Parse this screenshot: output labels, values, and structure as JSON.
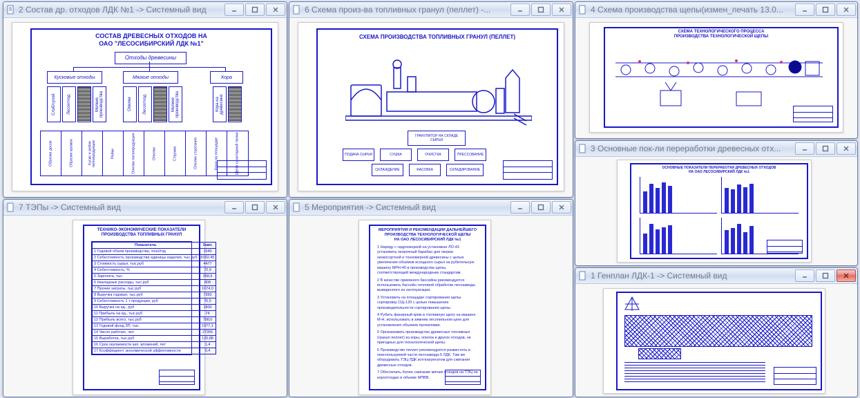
{
  "colors": {
    "line": "#1717c9"
  },
  "windows": {
    "w1": {
      "title": "2 Состав др. отходов ЛДК №1 -> Системный вид"
    },
    "w2": {
      "title": "6 Схема произ-ва топливных гранул (пеллет) -..."
    },
    "w3": {
      "title": "4 Схема производства щепы(измен_печать 13.0..."
    },
    "w4": {
      "title": "7 ТЭПы -> Системный вид"
    },
    "w5": {
      "title": "5 Мероприятия -> Системный вид"
    },
    "w6": {
      "title": "3 Основные пок-ли переработки древесных отх..."
    },
    "w7": {
      "title": "1 Генплан ЛДК-1 -> Системный вид"
    }
  },
  "w1_drawing": {
    "title1": "СОСТАВ ДРЕВЕСНЫХ ОТХОДОВ НА",
    "title2": "ОАО \"ЛЕСОСИБИРСКИЙ ЛДК №1\"",
    "root": "Отходы древесины",
    "level2": [
      "Кусковые отходы",
      "Мягкие отходы",
      "Кора"
    ],
    "kusk": [
      "Слэб/сухой",
      "Лесоотход",
      "Мелкие производства"
    ],
    "myag": [
      "Опилки",
      "Лесоотход",
      "Мелкие производства"
    ],
    "kora": [
      "Кора на древесине"
    ],
    "bottom": [
      "Обрезки досок",
      "Обрезки кромок",
      "Куски и рейки пилопродукции",
      "Рейки",
      "Опилки пилопродукции",
      "Опилки",
      "Стружки",
      "Опилки строгания",
      "Кора на площадке",
      "Щепа санитарной пилки"
    ]
  },
  "w2_drawing": {
    "title": "СХЕМА ПРОИЗВОДСТВА ТОПЛИВНЫХ ГРАНУЛ (ПЕЛЛЕТ)",
    "flow_center": "ГРАНУЛЯТОР НА СКЛАДЕ СЫРЬЯ",
    "flow": [
      "ПОДАЧА СЫРЬЯ",
      "СУШКА",
      "ОЧИСТКА",
      "ПРЕССОВАНИЕ",
      "ОХЛАЖДЕНИЕ",
      "ФАСОВКА",
      "СКЛАДИРОВАНИЕ"
    ]
  },
  "w3_drawing": {
    "title1": "СХЕМА ТЕХНОЛОГИЧЕСКОГО ПРОЦЕССА",
    "title2": "ПРОИЗВОДСТВА ТЕХНОЛОГИЧЕСКОЙ ЩЕПЫ"
  },
  "w4_drawing": {
    "title1": "ТЕХНИКО-ЭКОНОМИЧЕСКИЕ ПОКАЗАТЕЛИ",
    "title2": "ПРОИЗВОДСТВА ТОПЛИВНЫХ ГРАНУЛ",
    "head": [
      "Показатель",
      "Знач."
    ],
    "rows": [
      [
        "1 Годовой объем производства, тонн/год",
        "1540"
      ],
      [
        "2 Себестоимость производства единицы изделия, тыс.руб",
        "6002,45"
      ],
      [
        "3 Стоимость сырья, тыс.руб",
        "4477"
      ],
      [
        "4 Себестоимость, %",
        "72,9"
      ],
      [
        "5 Зарплата, тыс.",
        "358,9"
      ],
      [
        "6 Накладные расходы, тыс.руб",
        "808"
      ],
      [
        "7 Прочие затраты, тыс.руб",
        "1074,0"
      ],
      [
        "8 Выручка годовая, тыс.руб",
        "7350"
      ],
      [
        "9 Себестоимость 1 т продукции, руб",
        "76,5"
      ],
      [
        "10 Выручка на ед., руб",
        "1800"
      ],
      [
        "11 Прибыль на ед., тыс.руб",
        "74"
      ],
      [
        "12 Прибыль всего, тыс.руб",
        "798,0"
      ],
      [
        "13 Годовой фонд ЗП, тыс.",
        "1977,1"
      ],
      [
        "14 Число рабочих, чел",
        "27355"
      ],
      [
        "15 Выработка, тыс.руб",
        "120,88"
      ],
      [
        "16 Срок окупаемости кап. вложений, лет",
        "1,4"
      ],
      [
        "17 Коэффициент экономической эффективности",
        "0,4"
      ]
    ]
  },
  "w5_drawing": {
    "title1": "МЕРОПРИЯТИЯ И РЕКОМЕНДАЦИИ ДАЛЬНЕЙШЕГО",
    "title2": "ПРОИЗВОДСТВА ТЕХНОЛОГИЧЕСКОЙ ЩЕПЫ",
    "title3": "НА ОАО ЛЕСОСИБИРСКИЙ ЛДК №1",
    "items": [
      "1 Наряду с гидроокоркой на установках ЛО-43 установить окорочный барабан для окорки низкосортной и тонкомерной древесины с целью увеличения объёмов исходного сырья на рубительную машину МРН-40 и производства щепы, соответствующей международным стандартам.",
      "2 В качестве приемного бассейна рекомендуется использовать бассейн тепловой обработки лесозавода, выведенного из эксплуатации.",
      "3 Установить на площадке сортирования щепы сортировку СЩ-120 с целью повышения производительности сортирования щепы.",
      "4 Рубить фанерный кряж в топливную щепу на машине М-Н, использовать в зимнем лесопильном цехе для установления объемов пропиловки.",
      "5 Организовать производство древесных топливных (гранул пеллет) из коры, опилок и других отходов, не пригодных для технологической щепы.",
      "6 Производство пеллет рекомендуется разместить в неиспользуемой части лесозавода-5 ЛДК. Там же оборудовать ТЭЦ ЛДК котлоагрегатом для сжигания древесных отходов.",
      "7 Обеспечить более сжигание мягких отходов на ТЭЦ на короотходах в объеме МПВВ."
    ]
  },
  "w6_drawing": {
    "title1": "ОСНОВНЫЕ ПОКАЗАТЕЛИ ПЕРЕРАБОТКИ ДРЕВЕСНЫХ ОТХОДОВ",
    "title2": "НА ОАО ЛЕСОСИБИРСКИЙ ЛДК №1"
  },
  "w7_drawing": {}
}
